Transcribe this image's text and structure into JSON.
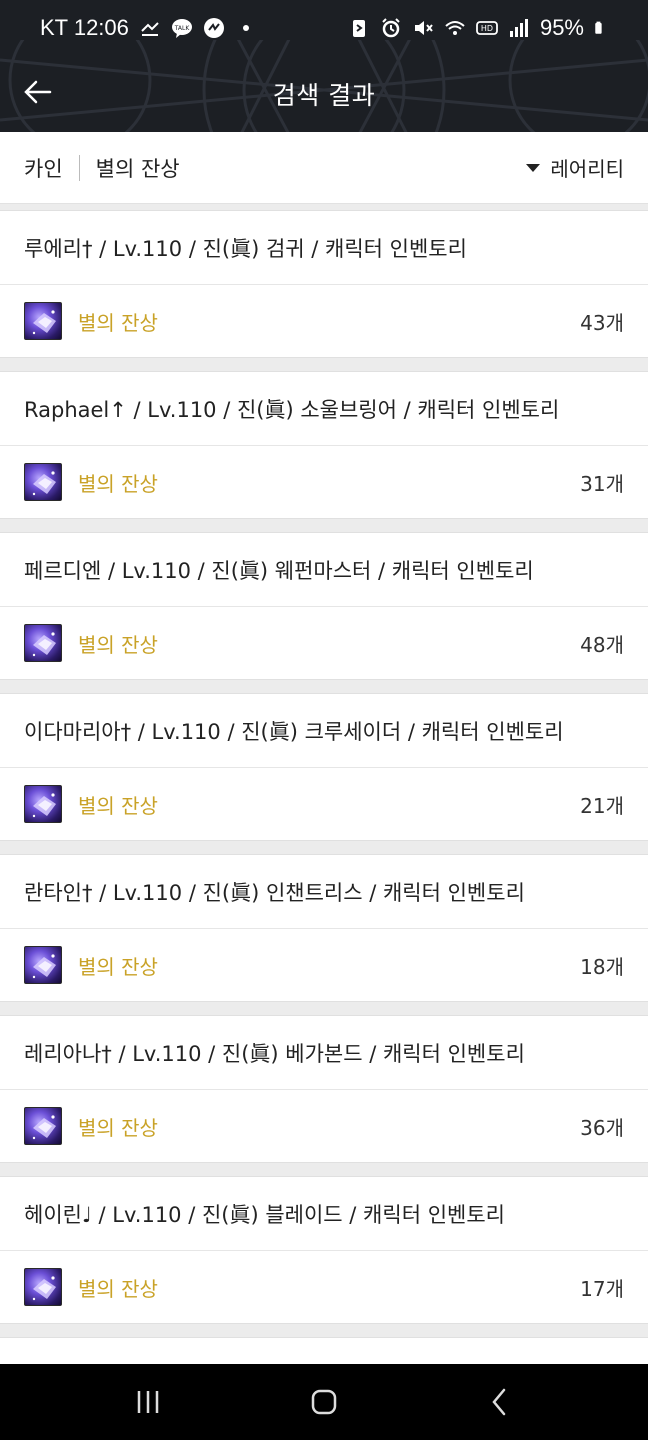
{
  "status_bar": {
    "carrier_time": "KT 12:06",
    "battery": "95%",
    "icons": [
      "missed-call-icon",
      "talk-icon",
      "app-icon",
      "dot-icon",
      "battery-saver-icon",
      "alarm-icon",
      "mute-icon",
      "wifi-icon",
      "hd-icon",
      "signal-icon",
      "battery-icon"
    ]
  },
  "header": {
    "title": "검색 결과",
    "back_icon": "arrow-left-icon"
  },
  "filter": {
    "server": "카인",
    "item": "별의 잔상",
    "sort_label": "레어리티"
  },
  "results": [
    {
      "title": "루에리† / Lv.110 / 진(眞) 검귀 / 캐릭터 인벤토리",
      "item_name": "별의 잔상",
      "count": "43개"
    },
    {
      "title": "Raphael↑ / Lv.110 / 진(眞) 소울브링어 / 캐릭터 인벤토리",
      "item_name": "별의 잔상",
      "count": "31개"
    },
    {
      "title": "페르디엔 / Lv.110 / 진(眞) 웨펀마스터 / 캐릭터 인벤토리",
      "item_name": "별의 잔상",
      "count": "48개"
    },
    {
      "title": "이다마리아† / Lv.110 / 진(眞) 크루세이더 / 캐릭터 인벤토리",
      "item_name": "별의 잔상",
      "count": "21개"
    },
    {
      "title": "란타인† / Lv.110 / 진(眞) 인챈트리스 / 캐릭터 인벤토리",
      "item_name": "별의 잔상",
      "count": "18개"
    },
    {
      "title": "레리아나† / Lv.110 / 진(眞) 베가본드 / 캐릭터 인벤토리",
      "item_name": "별의 잔상",
      "count": "36개"
    },
    {
      "title": "헤이린♩ / Lv.110 / 진(眞) 블레이드 / 캐릭터 인벤토리",
      "item_name": "별의 잔상",
      "count": "17개"
    },
    {
      "title": "",
      "item_name": "",
      "count": ""
    }
  ],
  "navbar": {
    "icons": [
      "recent-apps-icon",
      "home-icon",
      "back-icon"
    ]
  },
  "colors": {
    "header_bg": "#1c1f24",
    "item_name": "#c9a227",
    "page_bg": "#ececec"
  }
}
